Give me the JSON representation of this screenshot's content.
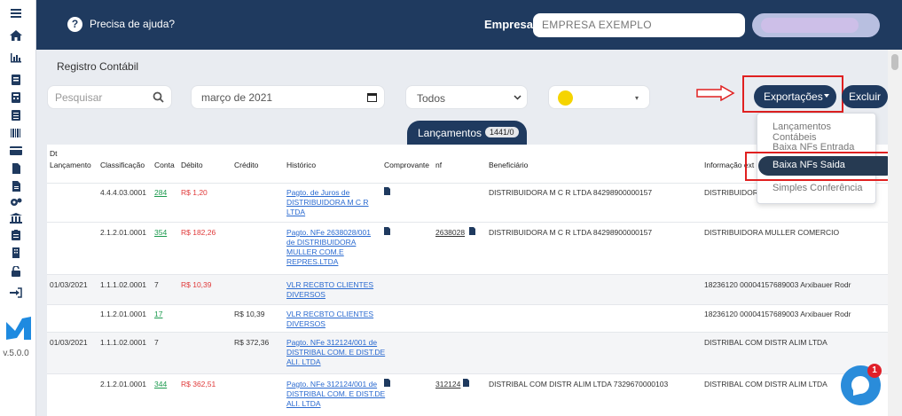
{
  "header": {
    "help_text": "Precisa de ajuda?",
    "empresa_label": "Empresa:",
    "empresa_value": "EMPRESA EXEMPLO"
  },
  "page_title": "Registro Contábil",
  "filters": {
    "search_placeholder": "Pesquisar",
    "date_value": "março de 2021",
    "type_select": "Todos"
  },
  "toolbar": {
    "export_label": "Exportações",
    "delete_label": "Excluir"
  },
  "export_menu": {
    "items": [
      "Lançamentos Contábeis",
      "Baixa NFs Entrada",
      "Baixa NFs Saida",
      "Simples Conferência"
    ]
  },
  "tab": {
    "label": "Lançamentos",
    "badge": "1441/0"
  },
  "table": {
    "headers": {
      "dt": "Dt",
      "lancamento": "Lançamento",
      "classificacao": "Classificação",
      "conta": "Conta",
      "debito": "Débito",
      "credito": "Crédito",
      "historico": "Histórico",
      "comprovante": "Comprovante",
      "nf": "nf",
      "beneficiario": "Beneficiário",
      "informacao": "Informação ext"
    },
    "rows": [
      {
        "data": "",
        "classificacao": "4.4.4.03.0001",
        "conta": "284",
        "debito": "R$ 1,20",
        "credito": "",
        "historico": [
          "Pagto. de Juros de",
          "DISTRIBUIDORA M C R",
          "LTDA"
        ],
        "nf": "",
        "beneficiario": "DISTRIBUIDORA M C R LTDA 84298900000157",
        "info": "DISTRIBUIDORA M C R LTDA"
      },
      {
        "data": "",
        "classificacao": "2.1.2.01.0001",
        "conta": "354",
        "debito": "R$ 182,26",
        "credito": "",
        "historico": [
          "Pagto. NFe 2638028/001",
          "de DISTRIBUIDORA",
          "MULLER COM.E",
          "REPRES.LTDA"
        ],
        "nf": "2638028",
        "beneficiario": "DISTRIBUIDORA M C R LTDA 84298900000157",
        "info": "DISTRIBUIDORA MULLER COMERCIO"
      },
      {
        "data": "01/03/2021",
        "classificacao": "1.1.1.02.0001",
        "conta": "7",
        "debito": "R$ 10,39",
        "credito": "",
        "historico": [
          "VLR RECBTO CLIENTES",
          "DIVERSOS"
        ],
        "nf": "",
        "beneficiario": "",
        "info": "18236120 00004157689003 Arxibauer Rodr"
      },
      {
        "data": "",
        "classificacao": "1.1.2.01.0001",
        "conta": "17",
        "debito": "",
        "credito": "R$ 10,39",
        "historico": [
          "VLR RECBTO CLIENTES",
          "DIVERSOS"
        ],
        "nf": "",
        "beneficiario": "",
        "info": "18236120 00004157689003 Arxibauer Rodr"
      },
      {
        "data": "01/03/2021",
        "classificacao": "1.1.1.02.0001",
        "conta": "7",
        "debito": "",
        "credito": "R$ 372,36",
        "historico": [
          "Pagto. NFe 312124/001 de",
          "DISTRIBAL COM. E DIST.DE",
          "ALI. LTDA"
        ],
        "nf": "",
        "beneficiario": "",
        "info": "DISTRIBAL COM DISTR ALIM LTDA"
      },
      {
        "data": "",
        "classificacao": "2.1.2.01.0001",
        "conta": "344",
        "debito": "R$ 362,51",
        "credito": "",
        "historico": [
          "Pagto. NFe 312124/001 de",
          "DISTRIBAL COM. E DIST.DE",
          "ALI. LTDA"
        ],
        "nf": "312124",
        "beneficiario": "DISTRIBAL COM DISTR ALIM LTDA 7329670000103",
        "info": "DISTRIBAL COM DISTR ALIM LTDA"
      }
    ]
  },
  "sidebar": {
    "version": "v.5.0.0"
  },
  "chat": {
    "badge": "1"
  },
  "colors": {
    "primary": "#1f3a5f",
    "accent_red": "#e02020",
    "link": "#2a6ad0",
    "debit": "#e03a3a"
  }
}
